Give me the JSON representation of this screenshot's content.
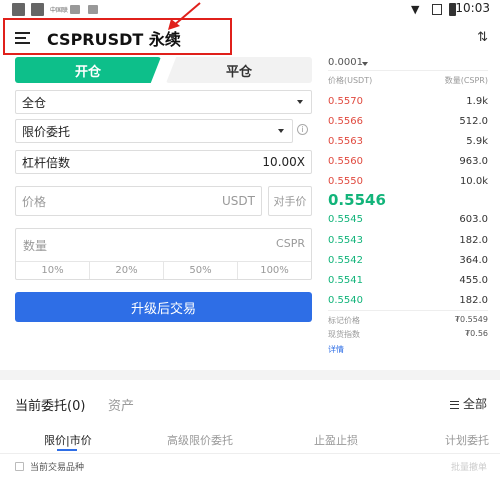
{
  "status_bar": {
    "carrier_text": "中国联",
    "time": "10:03"
  },
  "header": {
    "title": "CSPRUSDT 永续"
  },
  "trade_tabs": {
    "open": "开仓",
    "close": "平仓"
  },
  "margin_mode": "全仓",
  "order_type": "限价委托",
  "leverage": {
    "label": "杠杆倍数",
    "value": "10.00X"
  },
  "price_input": {
    "placeholder": "价格",
    "unit": "USDT",
    "opponent_label": "对手价"
  },
  "quantity": {
    "placeholder": "数量",
    "unit": "CSPR",
    "percents": [
      "10%",
      "20%",
      "50%",
      "100%"
    ]
  },
  "upgrade_button": "升级后交易",
  "order_book": {
    "step": "0.0001",
    "price_header": "价格(USDT)",
    "qty_header": "数量(CSPR)",
    "asks": [
      {
        "price": "0.5570",
        "qty": "1.9k"
      },
      {
        "price": "0.5566",
        "qty": "512.0"
      },
      {
        "price": "0.5563",
        "qty": "5.9k"
      },
      {
        "price": "0.5560",
        "qty": "963.0"
      },
      {
        "price": "0.5550",
        "qty": "10.0k"
      }
    ],
    "last_price": "0.5546",
    "bids": [
      {
        "price": "0.5545",
        "qty": "603.0"
      },
      {
        "price": "0.5543",
        "qty": "182.0"
      },
      {
        "price": "0.5542",
        "qty": "364.0"
      },
      {
        "price": "0.5541",
        "qty": "455.0"
      },
      {
        "price": "0.5540",
        "qty": "182.0"
      }
    ],
    "mark_price_label": "标记价格",
    "mark_price": "₮0.5549",
    "index_price_label": "现货指数",
    "index_price": "₮0.56",
    "detail_link": "详情"
  },
  "bottom": {
    "current_orders": "当前委托(0)",
    "assets": "资产",
    "all_label": "全部",
    "subtabs": [
      "限价|市价",
      "高级限价委托",
      "止盈止损",
      "计划委托"
    ],
    "current_pair_label": "当前交易品种",
    "batch_cancel": "批量撤单"
  },
  "colors": {
    "open_tab": "#0dbf8a",
    "ask": "#e04a3f",
    "bid": "#12b47a",
    "primary_button": "#2e6ee6",
    "highlight": "#e0201b"
  }
}
